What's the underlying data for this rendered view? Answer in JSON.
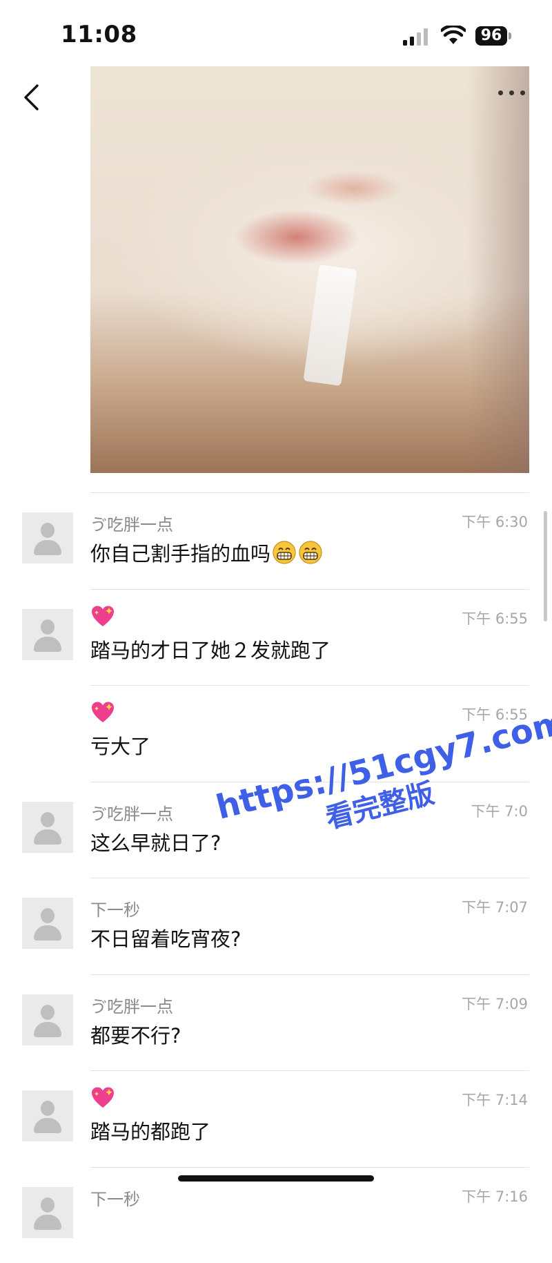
{
  "status_bar": {
    "time": "11:08",
    "battery": "96"
  },
  "comments": [
    {
      "name": "ゔ吃胖一点",
      "heart": false,
      "time": "下午 6:30",
      "text": "你自己割手指的血吗",
      "grin_count": 2,
      "avatar": true
    },
    {
      "name": "",
      "heart": true,
      "time": "下午 6:55",
      "text": "踏马的才日了她２发就跑了",
      "grin_count": 0,
      "avatar": true
    },
    {
      "name": "",
      "heart": true,
      "time": "下午 6:55",
      "text": "亏大了",
      "grin_count": 0,
      "avatar": false
    },
    {
      "name": "ゔ吃胖一点",
      "heart": false,
      "time": "下午 7:0",
      "text": "这么早就日了?",
      "grin_count": 0,
      "avatar": true
    },
    {
      "name": "下一秒",
      "heart": false,
      "time": "下午 7:07",
      "text": "不日留着吃宵夜?",
      "grin_count": 0,
      "avatar": true
    },
    {
      "name": "ゔ吃胖一点",
      "heart": false,
      "time": "下午 7:09",
      "text": "都要不行?",
      "grin_count": 0,
      "avatar": true
    },
    {
      "name": "",
      "heart": true,
      "time": "下午 7:14",
      "text": "踏马的都跑了",
      "grin_count": 0,
      "avatar": true
    },
    {
      "name": "下一秒",
      "heart": false,
      "time": "下午 7:16",
      "text": "",
      "grin_count": 0,
      "avatar": true
    }
  ],
  "watermark": {
    "url": "https://51cgy7.com",
    "subtitle": "看完整版"
  },
  "colors": {
    "watermark": "#3e5fe6",
    "meta_text": "#8a8a8a",
    "divider": "#e4e4e4"
  },
  "icons": {
    "back": "chevron-left-icon",
    "more": "more-icon",
    "heart": "sparkling-heart-icon",
    "grin": "grinning-face-icon"
  }
}
